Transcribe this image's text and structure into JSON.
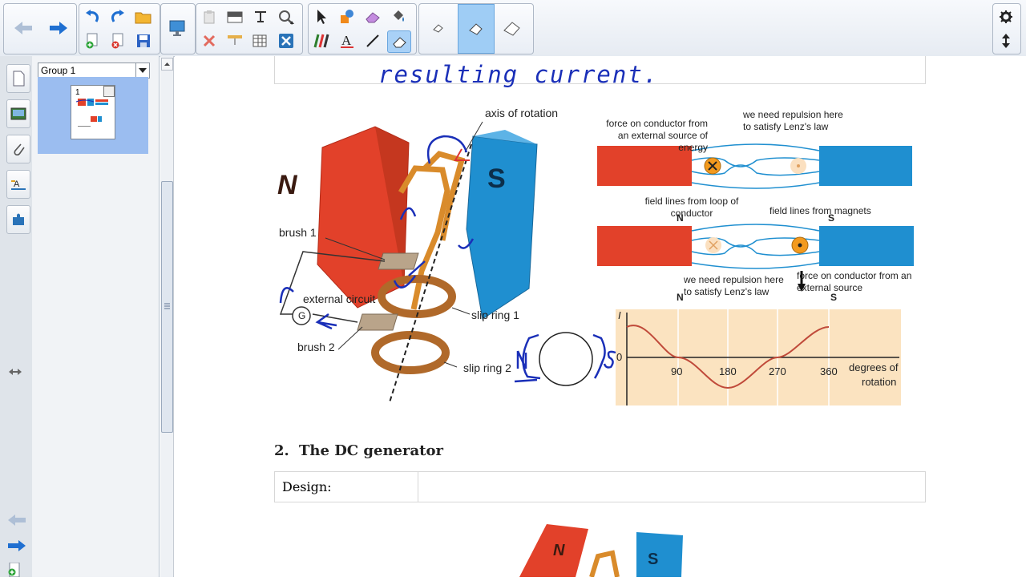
{
  "toolbar": {
    "back_label": "Back",
    "forward_label": "Next",
    "undo_label": "Undo",
    "redo_label": "Redo",
    "open_label": "Open",
    "add_page_label": "Add Page",
    "delete_page_label": "Delete Page",
    "save_label": "Save",
    "display_label": "Display",
    "paste_label": "Paste",
    "screenshade_label": "Screen Shade",
    "capture_label": "Capture",
    "text_tool_label": "Text",
    "delete_label": "Delete",
    "table_label": "Table",
    "close_label": "Close",
    "select_label": "Select",
    "fill_label": "Fill",
    "eraser_label": "Eraser",
    "pen_label": "Pens",
    "creative_pen_label": "Creative Pens",
    "text_label": "Text",
    "line_label": "Lines",
    "magic_pen_label": "Magic Pen",
    "eraser_size_small": "Small Eraser",
    "eraser_size_medium": "Medium Eraser",
    "eraser_size_large": "Large Eraser",
    "settings_label": "Settings",
    "move_toolbar_label": "Move Toolbar"
  },
  "sorter": {
    "group_name": "Group 1",
    "page_number": "1"
  },
  "document": {
    "handwritten_top": "resulting current.",
    "diagram_left": {
      "axis_label": "axis of rotation",
      "brush1": "brush 1",
      "external_circuit": "external circuit",
      "brush2": "brush 2",
      "slip_ring1": "slip ring 1",
      "slip_ring2": "slip ring 2",
      "galvanometer": "G",
      "north": "N",
      "south": "S"
    },
    "diagram_right": {
      "top_force": "force on conductor from an external source of energy",
      "top_repulsion": "we need repulsion here to satisfy Lenz's law",
      "field_loop": "field lines from loop of conductor",
      "field_magnets": "field lines from magnets",
      "bottom_repulsion": "we need repulsion here to satisfy Lenz's law",
      "bottom_force": "force on conductor from an external source",
      "north": "N",
      "south": "S"
    },
    "graph": {
      "ylabel": "I",
      "zero": "0",
      "xticks": [
        "90",
        "180",
        "270",
        "360"
      ],
      "xlabel_line1": "degrees of",
      "xlabel_line2": "rotation"
    },
    "handwritten_n": "N",
    "handwritten_s": "S",
    "section_number": "2.",
    "section_title": "The DC generator",
    "design_label": "Design:",
    "bottom_north": "N",
    "bottom_south": "S"
  },
  "colors": {
    "magnet_red": "#e2412a",
    "magnet_blue": "#1f8fd0",
    "ink_blue": "#1a2fb8",
    "graph_bg": "#fbe3c0",
    "selection": "#a9d1f7"
  }
}
